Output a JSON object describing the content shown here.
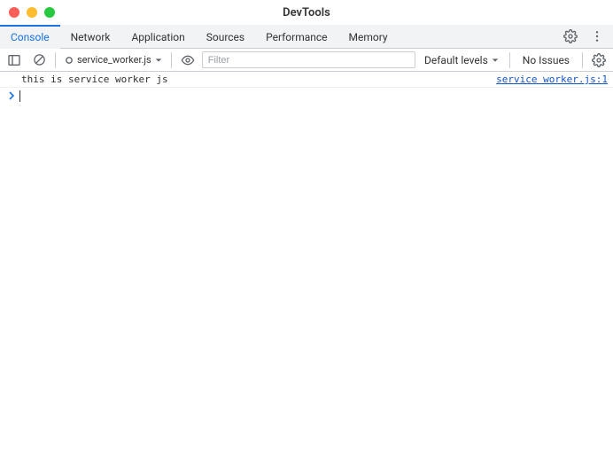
{
  "window": {
    "title": "DevTools"
  },
  "tabs": [
    {
      "label": "Console",
      "active": true
    },
    {
      "label": "Network",
      "active": false
    },
    {
      "label": "Application",
      "active": false
    },
    {
      "label": "Sources",
      "active": false
    },
    {
      "label": "Performance",
      "active": false
    },
    {
      "label": "Memory",
      "active": false
    }
  ],
  "toolbar": {
    "context": "service_worker.js",
    "filter_placeholder": "Filter",
    "filter_value": "",
    "levels_label": "Default levels",
    "issues_label": "No Issues"
  },
  "console": {
    "rows": [
      {
        "message": "this is service worker js",
        "source": "service worker.js:1"
      }
    ],
    "prompt_value": ""
  }
}
